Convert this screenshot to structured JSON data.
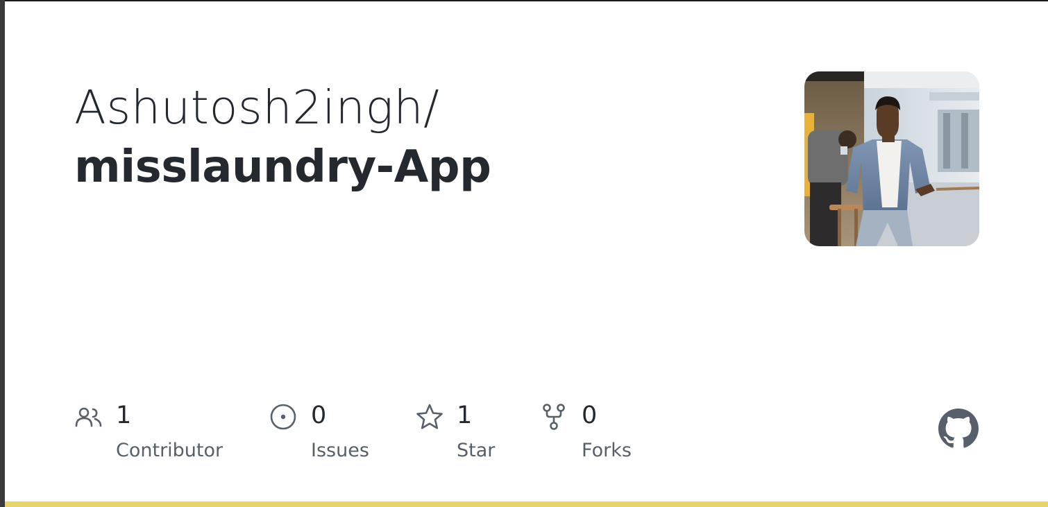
{
  "repo": {
    "owner": "Ashutosh2ingh/",
    "name": "misslaundry-App"
  },
  "stats": [
    {
      "icon": "contributors-icon",
      "count": "1",
      "label": "Contributor"
    },
    {
      "icon": "issues-icon",
      "count": "0",
      "label": "Issues"
    },
    {
      "icon": "star-icon",
      "count": "1",
      "label": "Star"
    },
    {
      "icon": "fork-icon",
      "count": "0",
      "label": "Forks"
    }
  ],
  "icons": {
    "avatar": "owner-avatar-photo",
    "brand": "github-icon"
  },
  "colors": {
    "text": "#24292f",
    "muted": "#57606a",
    "accent_bar": "#e6d56c",
    "github_icon": "#57606a"
  }
}
